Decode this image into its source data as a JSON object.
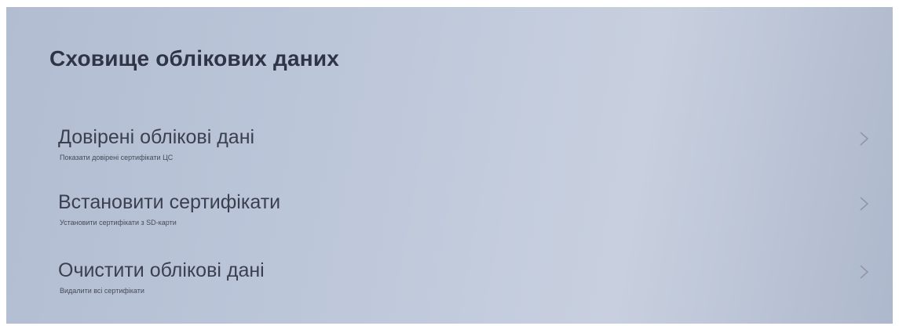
{
  "page": {
    "title": "Сховище облікових даних"
  },
  "items": [
    {
      "title": "Довірені облікові дані",
      "subtitle": "Показати довірені сертифікати ЦС",
      "icon": "chevron-right-icon"
    },
    {
      "title": "Встановити сертифікати",
      "subtitle": "Установити сертифікати з SD-карти",
      "icon": "chevron-right-icon"
    },
    {
      "title": "Очистити облікові дані",
      "subtitle": "Видалити всі сертифікати",
      "icon": "chevron-right-icon"
    }
  ]
}
